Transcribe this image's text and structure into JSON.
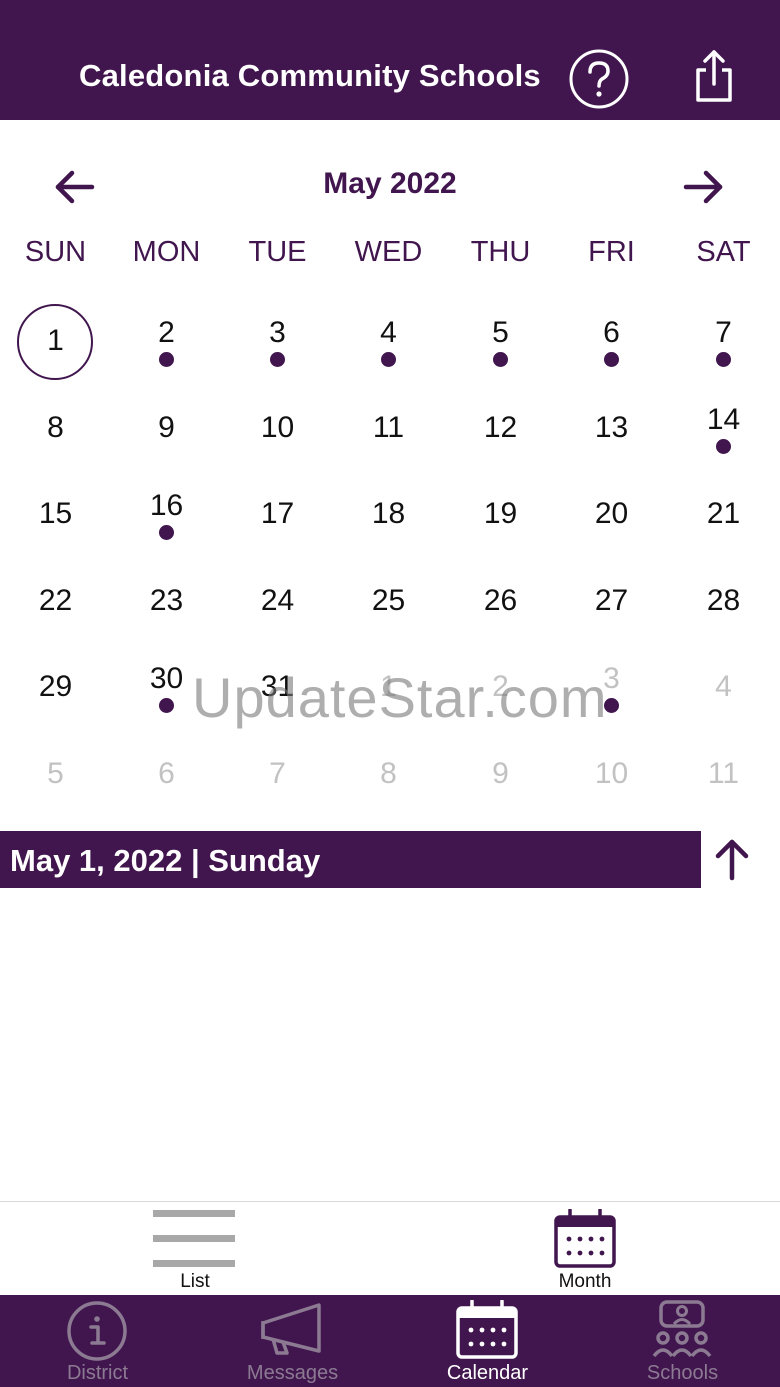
{
  "header": {
    "title": "Caledonia Community Schools",
    "help_icon": "question-circle-icon",
    "share_icon": "share-icon"
  },
  "calendar": {
    "month_title": "May 2022",
    "weekdays": [
      "SUN",
      "MON",
      "TUE",
      "WED",
      "THU",
      "FRI",
      "SAT"
    ],
    "weeks": [
      [
        {
          "day": "1",
          "selected": true
        },
        {
          "day": "2",
          "dot": true
        },
        {
          "day": "3",
          "dot": true
        },
        {
          "day": "4",
          "dot": true
        },
        {
          "day": "5",
          "dot": true
        },
        {
          "day": "6",
          "dot": true
        },
        {
          "day": "7",
          "dot": true
        }
      ],
      [
        {
          "day": "8"
        },
        {
          "day": "9"
        },
        {
          "day": "10"
        },
        {
          "day": "11"
        },
        {
          "day": "12"
        },
        {
          "day": "13"
        },
        {
          "day": "14",
          "dot": true
        }
      ],
      [
        {
          "day": "15"
        },
        {
          "day": "16",
          "dot": true
        },
        {
          "day": "17"
        },
        {
          "day": "18"
        },
        {
          "day": "19"
        },
        {
          "day": "20"
        },
        {
          "day": "21"
        }
      ],
      [
        {
          "day": "22"
        },
        {
          "day": "23"
        },
        {
          "day": "24"
        },
        {
          "day": "25"
        },
        {
          "day": "26"
        },
        {
          "day": "27"
        },
        {
          "day": "28"
        }
      ],
      [
        {
          "day": "29"
        },
        {
          "day": "30",
          "dot": true
        },
        {
          "day": "31"
        },
        {
          "day": "1",
          "muted": true
        },
        {
          "day": "2",
          "muted": true
        },
        {
          "day": "3",
          "muted": true,
          "dot": true
        },
        {
          "day": "4",
          "muted": true
        }
      ],
      [
        {
          "day": "5",
          "muted": true
        },
        {
          "day": "6",
          "muted": true
        },
        {
          "day": "7",
          "muted": true
        },
        {
          "day": "8",
          "muted": true
        },
        {
          "day": "9",
          "muted": true
        },
        {
          "day": "10",
          "muted": true
        },
        {
          "day": "11",
          "muted": true
        }
      ]
    ]
  },
  "watermark": "UpdateStar.com",
  "selected_date_label": "May 1, 2022 | Sunday",
  "view_toggle": {
    "list_label": "List",
    "month_label": "Month"
  },
  "tabs": [
    {
      "label": "District",
      "icon": "info-circle-icon",
      "active": false
    },
    {
      "label": "Messages",
      "icon": "megaphone-icon",
      "active": false
    },
    {
      "label": "Calendar",
      "icon": "calendar-icon",
      "active": true
    },
    {
      "label": "Schools",
      "icon": "people-icon",
      "active": false
    }
  ],
  "colors": {
    "brand": "#41164e",
    "muted_text": "#c2c2c2",
    "inactive_tab": "#8c7a93"
  }
}
